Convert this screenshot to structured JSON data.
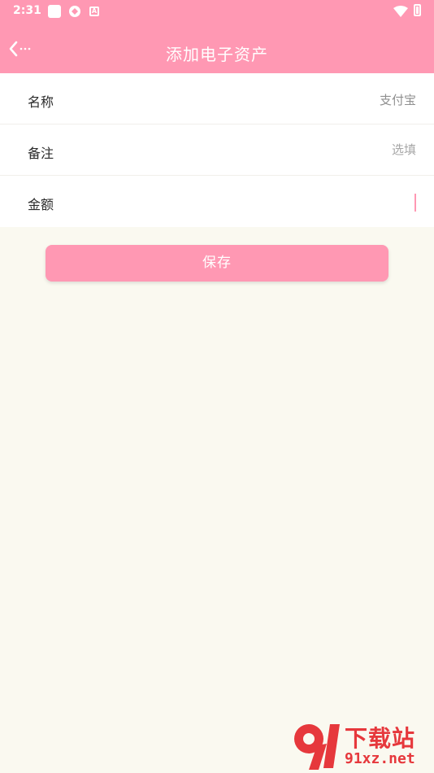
{
  "status_bar": {
    "time": "2:31",
    "icons": [
      "notification-square-icon",
      "sync-icon",
      "a-icon",
      "wifi-icon",
      "battery-icon"
    ],
    "a_icon_text": "A"
  },
  "header": {
    "title": "添加电子资产",
    "back_icon": "chevron-left-icon"
  },
  "form": {
    "name_label": "名称",
    "name_value": "支付宝",
    "note_label": "备注",
    "note_placeholder": "选填",
    "amount_label": "金额",
    "amount_value": ""
  },
  "save_label": "保存",
  "watermark": {
    "title": "下载站",
    "url": "91xz.net"
  },
  "colors": {
    "accent": "#ff98b3",
    "background": "#faf9f0",
    "watermark": "#e6383c"
  }
}
